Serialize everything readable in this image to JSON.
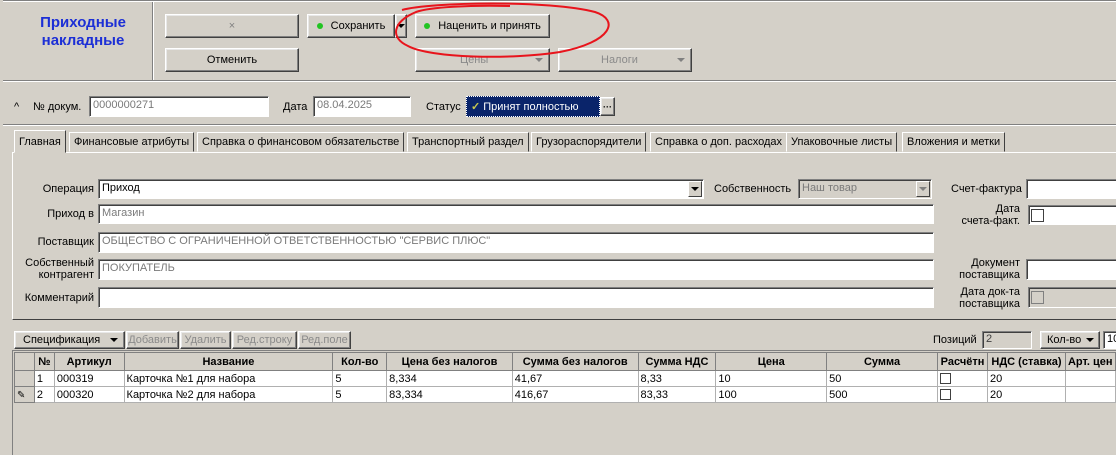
{
  "window_title": "Приходные накладные",
  "toolbar": {
    "cancel_x_label": "×",
    "save_label": "Сохранить",
    "markup_accept_label": "Наценить и принять",
    "revert_label": "Отменить",
    "prices_label": "Цены",
    "taxes_label": "Налоги"
  },
  "header": {
    "doc_num_label": "№ докум.",
    "doc_num_value": "0000000271",
    "date_label": "Дата",
    "date_value": "08.04.2025",
    "status_label": "Статус",
    "status_value": "Принят полностью",
    "status_more": "···"
  },
  "tabs": [
    "Главная",
    "Финансовые атрибуты",
    "Справка о финансовом обязательстве",
    "Транспортный раздел",
    "Грузораспорядители",
    "Справка о доп. расходах",
    "Упаковочные листы",
    "Вложения и метки"
  ],
  "form": {
    "operation_label": "Операция",
    "operation_value": "Приход",
    "ownership_label": "Собственность",
    "ownership_value": "Наш товар",
    "invoice_label": "Счет-фактура",
    "invoice_value": "",
    "income_to_label": "Приход в",
    "income_to_value": "Магазин",
    "invoice_date_label_1": "Дата",
    "invoice_date_label_2": "счета-факт.",
    "supplier_label": "Поставщик",
    "supplier_value": "ОБЩЕСТВО С ОГРАНИЧЕННОЙ ОТВЕТСТВЕННОСТЬЮ \"СЕРВИС ПЛЮС\"",
    "own_contractor_label_1": "Собственный",
    "own_contractor_label_2": "контрагент",
    "own_contractor_value": "ПОКУПАТЕЛЬ",
    "supplier_doc_label_1": "Документ",
    "supplier_doc_label_2": "поставщика",
    "supplier_doc_value": "",
    "comment_label": "Комментарий",
    "comment_value": "",
    "supplier_doc_date_label_1": "Дата док-та",
    "supplier_doc_date_label_2": "поставщика"
  },
  "spec_toolbar": {
    "spec_label": "Спецификация",
    "add_label": "Добавить",
    "delete_label": "Удалить",
    "edit_row_label": "Ред.строку",
    "edit_field_label": "Ред.поле",
    "positions_label": "Позиций",
    "positions_value": "2",
    "qty_label": "Кол-во",
    "extra_value": "10"
  },
  "table": {
    "columns": [
      "№",
      "Артикул",
      "Название",
      "Кол-во",
      "Цена без налогов",
      "Сумма без налогов",
      "Сумма НДС",
      "Цена",
      "Сумма",
      "Расчётн",
      "НДС (ставка)",
      "Арт. цен"
    ],
    "rows": [
      {
        "num": "1",
        "article": "000319",
        "name": "Карточка №1 для набора",
        "qty": "5",
        "price_net": "8,334",
        "sum_net": "41,67",
        "vat_sum": "8,33",
        "price": "10",
        "sum": "50",
        "calc": false,
        "vat_rate": "20",
        "art_price": ""
      },
      {
        "num": "2",
        "article": "000320",
        "name": "Карточка №2 для набора",
        "qty": "5",
        "price_net": "83,334",
        "sum_net": "416,67",
        "vat_sum": "83,33",
        "price": "100",
        "sum": "500",
        "calc": false,
        "vat_rate": "20",
        "art_price": ""
      }
    ]
  },
  "colors": {
    "window_bg": "#d4d0c8",
    "title_blue": "#1c2fd6",
    "status_bg": "#0a246a",
    "annotation_red": "#e8141c",
    "led_green": "#22c422"
  }
}
